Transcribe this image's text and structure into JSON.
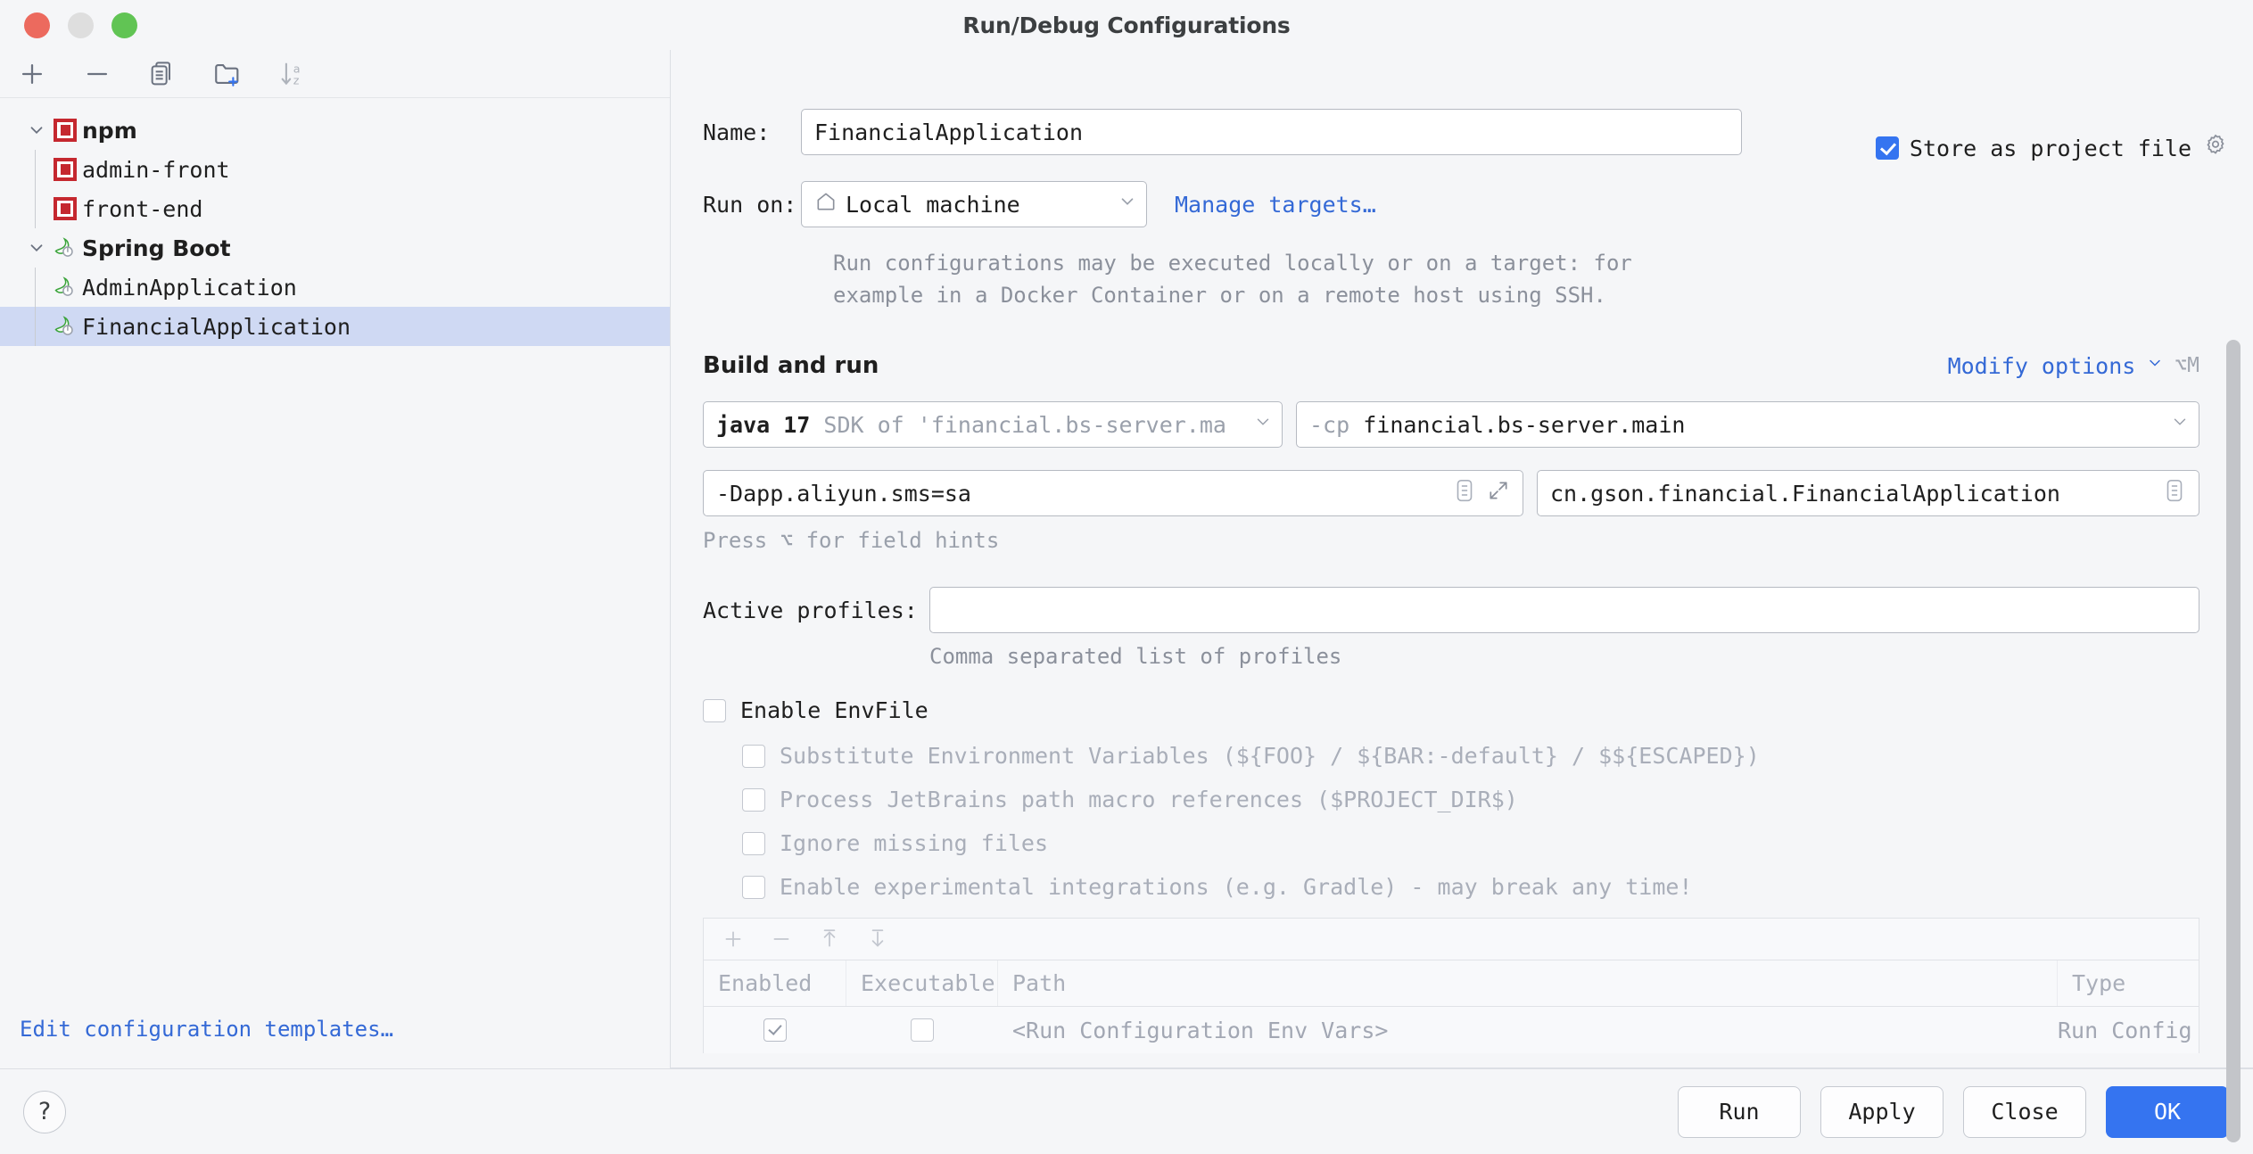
{
  "window": {
    "title": "Run/Debug Configurations",
    "traffic_lights": [
      "close",
      "minimize",
      "zoom"
    ]
  },
  "sidebar": {
    "toolbar": [
      {
        "name": "add-configuration-button",
        "icon": "plus-icon"
      },
      {
        "name": "remove-configuration-button",
        "icon": "minus-icon"
      },
      {
        "name": "copy-configuration-button",
        "icon": "copy-icon"
      },
      {
        "name": "new-folder-button",
        "icon": "new-folder-icon"
      },
      {
        "name": "sort-configurations-button",
        "icon": "sort-alphabetical-icon"
      }
    ],
    "tree": [
      {
        "label": "npm",
        "type": "group",
        "icon": "npm-icon",
        "expanded": true,
        "bold": true,
        "depth": 0
      },
      {
        "label": "admin-front",
        "type": "config",
        "icon": "npm-icon",
        "depth": 1
      },
      {
        "label": "front-end",
        "type": "config",
        "icon": "npm-icon",
        "depth": 1
      },
      {
        "label": "Spring Boot",
        "type": "group",
        "icon": "spring-boot-icon",
        "expanded": true,
        "bold": true,
        "depth": 0
      },
      {
        "label": "AdminApplication",
        "type": "config",
        "icon": "spring-boot-icon",
        "depth": 1
      },
      {
        "label": "FinancialApplication",
        "type": "config",
        "icon": "spring-boot-icon",
        "depth": 1,
        "selected": true
      }
    ],
    "edit_templates_link": "Edit configuration templates…"
  },
  "form": {
    "name_label": "Name:",
    "name_value": "FinancialApplication",
    "store_as_project_file": {
      "label": "Store as project file",
      "checked": true,
      "gear_icon": "gear-icon"
    },
    "run_on_label": "Run on:",
    "run_on_value": "Local machine",
    "run_on_icon": "home-icon",
    "manage_targets_link": "Manage targets…",
    "description": "Run configurations may be executed locally or on a target: for example in a Docker Container or on a remote host using SSH."
  },
  "build_and_run": {
    "title": "Build and run",
    "modify_options_link": "Modify options",
    "modify_options_shortcut": "⌥M",
    "sdk": {
      "version": "java 17",
      "detail": "SDK of 'financial.bs-server.ma"
    },
    "classpath": {
      "flag": "-cp",
      "value": "financial.bs-server.main"
    },
    "vm_options_value": "-Dapp.aliyun.sms=sa",
    "vm_options_icons": [
      "macro-list-icon",
      "expand-icon"
    ],
    "main_class_value": "cn.gson.financial.FinancialApplication",
    "main_class_icon": "macro-list-icon",
    "field_hint": "Press ⌥ for field hints"
  },
  "profiles": {
    "label": "Active profiles:",
    "value": "",
    "hint": "Comma separated list of profiles"
  },
  "envfile": {
    "enable_label": "Enable EnvFile",
    "enable_checked": false,
    "sub_options": [
      {
        "label": "Substitute Environment Variables (${FOO} / ${BAR:-default} / $${ESCAPED})",
        "checked": false
      },
      {
        "label": "Process JetBrains path macro references ($PROJECT_DIR$)",
        "checked": false
      },
      {
        "label": "Ignore missing files",
        "checked": false
      },
      {
        "label": "Enable experimental integrations (e.g. Gradle) - may break any time!",
        "checked": false
      }
    ],
    "table_toolbar": [
      {
        "name": "add-env-file-button",
        "icon": "plus-icon"
      },
      {
        "name": "remove-env-file-button",
        "icon": "minus-icon"
      },
      {
        "name": "move-up-button",
        "icon": "arrow-up-icon"
      },
      {
        "name": "move-down-button",
        "icon": "arrow-down-icon"
      }
    ],
    "table": {
      "columns": [
        "Enabled",
        "Executable",
        "Path",
        "Type"
      ],
      "rows": [
        {
          "enabled": true,
          "executable": false,
          "path": "<Run Configuration Env Vars>",
          "type": "Run Config"
        }
      ]
    }
  },
  "footer": {
    "help_label": "?",
    "buttons": [
      {
        "label": "Run",
        "primary": false
      },
      {
        "label": "Apply",
        "primary": false
      },
      {
        "label": "Close",
        "primary": false
      },
      {
        "label": "OK",
        "primary": true
      }
    ]
  },
  "colors": {
    "accent": "#3574f0",
    "link": "#3469d6",
    "selection": "#cfd9f3",
    "npm_red": "#c5282f",
    "spring_green": "#3aa33a",
    "background": "#f5f6f8",
    "muted_text": "#9aa0ab"
  }
}
